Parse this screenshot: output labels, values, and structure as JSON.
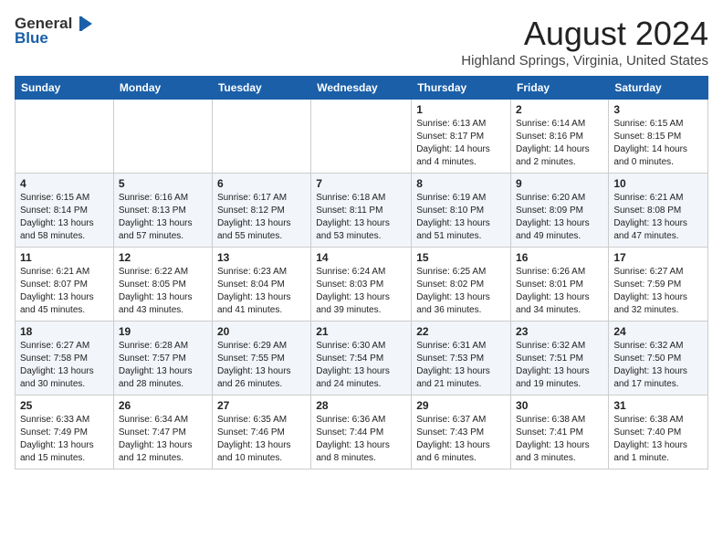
{
  "header": {
    "logo_general": "General",
    "logo_blue": "Blue",
    "month_year": "August 2024",
    "location": "Highland Springs, Virginia, United States"
  },
  "calendar": {
    "headers": [
      "Sunday",
      "Monday",
      "Tuesday",
      "Wednesday",
      "Thursday",
      "Friday",
      "Saturday"
    ],
    "weeks": [
      [
        {
          "day": "",
          "info": ""
        },
        {
          "day": "",
          "info": ""
        },
        {
          "day": "",
          "info": ""
        },
        {
          "day": "",
          "info": ""
        },
        {
          "day": "1",
          "info": "Sunrise: 6:13 AM\nSunset: 8:17 PM\nDaylight: 14 hours\nand 4 minutes."
        },
        {
          "day": "2",
          "info": "Sunrise: 6:14 AM\nSunset: 8:16 PM\nDaylight: 14 hours\nand 2 minutes."
        },
        {
          "day": "3",
          "info": "Sunrise: 6:15 AM\nSunset: 8:15 PM\nDaylight: 14 hours\nand 0 minutes."
        }
      ],
      [
        {
          "day": "4",
          "info": "Sunrise: 6:15 AM\nSunset: 8:14 PM\nDaylight: 13 hours\nand 58 minutes."
        },
        {
          "day": "5",
          "info": "Sunrise: 6:16 AM\nSunset: 8:13 PM\nDaylight: 13 hours\nand 57 minutes."
        },
        {
          "day": "6",
          "info": "Sunrise: 6:17 AM\nSunset: 8:12 PM\nDaylight: 13 hours\nand 55 minutes."
        },
        {
          "day": "7",
          "info": "Sunrise: 6:18 AM\nSunset: 8:11 PM\nDaylight: 13 hours\nand 53 minutes."
        },
        {
          "day": "8",
          "info": "Sunrise: 6:19 AM\nSunset: 8:10 PM\nDaylight: 13 hours\nand 51 minutes."
        },
        {
          "day": "9",
          "info": "Sunrise: 6:20 AM\nSunset: 8:09 PM\nDaylight: 13 hours\nand 49 minutes."
        },
        {
          "day": "10",
          "info": "Sunrise: 6:21 AM\nSunset: 8:08 PM\nDaylight: 13 hours\nand 47 minutes."
        }
      ],
      [
        {
          "day": "11",
          "info": "Sunrise: 6:21 AM\nSunset: 8:07 PM\nDaylight: 13 hours\nand 45 minutes."
        },
        {
          "day": "12",
          "info": "Sunrise: 6:22 AM\nSunset: 8:05 PM\nDaylight: 13 hours\nand 43 minutes."
        },
        {
          "day": "13",
          "info": "Sunrise: 6:23 AM\nSunset: 8:04 PM\nDaylight: 13 hours\nand 41 minutes."
        },
        {
          "day": "14",
          "info": "Sunrise: 6:24 AM\nSunset: 8:03 PM\nDaylight: 13 hours\nand 39 minutes."
        },
        {
          "day": "15",
          "info": "Sunrise: 6:25 AM\nSunset: 8:02 PM\nDaylight: 13 hours\nand 36 minutes."
        },
        {
          "day": "16",
          "info": "Sunrise: 6:26 AM\nSunset: 8:01 PM\nDaylight: 13 hours\nand 34 minutes."
        },
        {
          "day": "17",
          "info": "Sunrise: 6:27 AM\nSunset: 7:59 PM\nDaylight: 13 hours\nand 32 minutes."
        }
      ],
      [
        {
          "day": "18",
          "info": "Sunrise: 6:27 AM\nSunset: 7:58 PM\nDaylight: 13 hours\nand 30 minutes."
        },
        {
          "day": "19",
          "info": "Sunrise: 6:28 AM\nSunset: 7:57 PM\nDaylight: 13 hours\nand 28 minutes."
        },
        {
          "day": "20",
          "info": "Sunrise: 6:29 AM\nSunset: 7:55 PM\nDaylight: 13 hours\nand 26 minutes."
        },
        {
          "day": "21",
          "info": "Sunrise: 6:30 AM\nSunset: 7:54 PM\nDaylight: 13 hours\nand 24 minutes."
        },
        {
          "day": "22",
          "info": "Sunrise: 6:31 AM\nSunset: 7:53 PM\nDaylight: 13 hours\nand 21 minutes."
        },
        {
          "day": "23",
          "info": "Sunrise: 6:32 AM\nSunset: 7:51 PM\nDaylight: 13 hours\nand 19 minutes."
        },
        {
          "day": "24",
          "info": "Sunrise: 6:32 AM\nSunset: 7:50 PM\nDaylight: 13 hours\nand 17 minutes."
        }
      ],
      [
        {
          "day": "25",
          "info": "Sunrise: 6:33 AM\nSunset: 7:49 PM\nDaylight: 13 hours\nand 15 minutes."
        },
        {
          "day": "26",
          "info": "Sunrise: 6:34 AM\nSunset: 7:47 PM\nDaylight: 13 hours\nand 12 minutes."
        },
        {
          "day": "27",
          "info": "Sunrise: 6:35 AM\nSunset: 7:46 PM\nDaylight: 13 hours\nand 10 minutes."
        },
        {
          "day": "28",
          "info": "Sunrise: 6:36 AM\nSunset: 7:44 PM\nDaylight: 13 hours\nand 8 minutes."
        },
        {
          "day": "29",
          "info": "Sunrise: 6:37 AM\nSunset: 7:43 PM\nDaylight: 13 hours\nand 6 minutes."
        },
        {
          "day": "30",
          "info": "Sunrise: 6:38 AM\nSunset: 7:41 PM\nDaylight: 13 hours\nand 3 minutes."
        },
        {
          "day": "31",
          "info": "Sunrise: 6:38 AM\nSunset: 7:40 PM\nDaylight: 13 hours\nand 1 minute."
        }
      ]
    ]
  }
}
